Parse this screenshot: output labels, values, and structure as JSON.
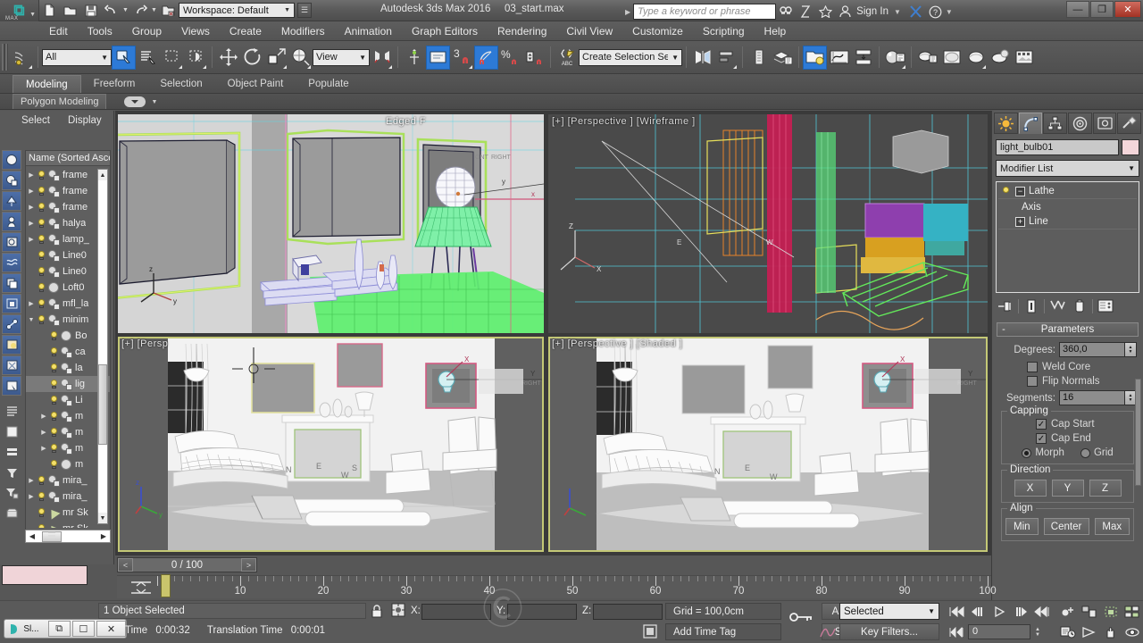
{
  "app": {
    "title": "Autodesk 3ds Max 2016",
    "file": "03_start.max",
    "logo_text": "MAX",
    "workspace_label": "Workspace: Default",
    "search_placeholder": "Type a keyword or phrase",
    "sign_in": "Sign In",
    "window_buttons": {
      "minimize": "—",
      "restore": "❐",
      "close": "✕"
    }
  },
  "menu": {
    "items": [
      "Edit",
      "Tools",
      "Group",
      "Views",
      "Create",
      "Modifiers",
      "Animation",
      "Graph Editors",
      "Rendering",
      "Civil View",
      "Customize",
      "Scripting",
      "Help"
    ]
  },
  "toolbar": {
    "selection_filter": "All",
    "reference_coord": "View",
    "named_selection_set": "Create Selection Se",
    "snap_number": "3",
    "percent_symbol": "%",
    "icons": [
      "undo-icon",
      "redo-icon",
      "select-link-icon",
      "unlink-icon",
      "bind-space-warp-icon",
      "select-object-icon",
      "select-by-name-icon",
      "rectangular-region-icon",
      "window-crossing-icon",
      "select-move-icon",
      "select-rotate-icon",
      "select-scale-icon",
      "reference-coordinate-icon",
      "use-pivot-center-icon",
      "mirror-icon",
      "align-icon",
      "layer-manager-icon",
      "snaps-toggle-icon",
      "angle-snap-icon",
      "percent-snap-icon",
      "spinner-snap-icon",
      "named-selection-sets-icon",
      "graphite-modeling-icon",
      "curve-editor-icon",
      "schematic-view-icon",
      "material-editor-icon",
      "render-setup-icon",
      "render-frame-icon",
      "render-production-icon",
      "material-explorer-icon"
    ]
  },
  "ribbon": {
    "tabs": [
      "Modeling",
      "Freeform",
      "Selection",
      "Object Paint",
      "Populate"
    ],
    "active_tab": "Modeling",
    "sub_tab": "Polygon Modeling"
  },
  "scene_explorer": {
    "menus": [
      "Select",
      "Display"
    ],
    "column_header": "Name (Sorted Ascer",
    "rows": [
      {
        "name": "frame",
        "expandable": true,
        "indent": 0,
        "icon": "group-icon"
      },
      {
        "name": "frame",
        "expandable": true,
        "indent": 0,
        "icon": "group-icon"
      },
      {
        "name": "frame",
        "expandable": true,
        "indent": 0,
        "icon": "group-icon"
      },
      {
        "name": "halya",
        "expandable": true,
        "indent": 0,
        "icon": "group-icon"
      },
      {
        "name": "lamp_",
        "expandable": true,
        "indent": 0,
        "icon": "group-icon"
      },
      {
        "name": "Line0",
        "expandable": false,
        "indent": 0,
        "icon": "shape-icon"
      },
      {
        "name": "Line0",
        "expandable": false,
        "indent": 0,
        "icon": "shape-icon"
      },
      {
        "name": "Loft0",
        "expandable": false,
        "indent": 0,
        "icon": "mesh-icon"
      },
      {
        "name": "mfl_la",
        "expandable": true,
        "indent": 0,
        "icon": "group-icon"
      },
      {
        "name": "minim",
        "expandable": true,
        "expanded": true,
        "indent": 0,
        "icon": "group-icon"
      },
      {
        "name": "Bo",
        "expandable": false,
        "indent": 1,
        "icon": "mesh-icon"
      },
      {
        "name": "ca",
        "expandable": false,
        "indent": 1,
        "icon": "shape-icon"
      },
      {
        "name": "la",
        "expandable": false,
        "indent": 1,
        "icon": "shape-icon"
      },
      {
        "name": "lig",
        "expandable": false,
        "indent": 1,
        "icon": "shape-icon",
        "selected": true
      },
      {
        "name": "Li",
        "expandable": false,
        "indent": 1,
        "icon": "shape-icon"
      },
      {
        "name": "m",
        "expandable": true,
        "indent": 1,
        "icon": "group-icon"
      },
      {
        "name": "m",
        "expandable": true,
        "indent": 1,
        "icon": "group-icon"
      },
      {
        "name": "m",
        "expandable": true,
        "indent": 1,
        "icon": "group-icon"
      },
      {
        "name": "m",
        "expandable": false,
        "indent": 1,
        "icon": "mesh-icon"
      },
      {
        "name": "mira_",
        "expandable": true,
        "indent": 0,
        "icon": "group-icon"
      },
      {
        "name": "mira_",
        "expandable": true,
        "indent": 0,
        "icon": "group-icon"
      },
      {
        "name": "mr Sk",
        "expandable": false,
        "indent": 0,
        "icon": "light-icon"
      },
      {
        "name": "mr Sk",
        "expandable": false,
        "indent": 0,
        "icon": "light-icon"
      }
    ]
  },
  "viewports": [
    {
      "id": "top-left",
      "label": "Edged F",
      "shading": "Edged Faces",
      "selected": false
    },
    {
      "id": "top-right",
      "label": "[+] [Perspective ] [Wireframe ]",
      "selected": false
    },
    {
      "id": "bottom-left",
      "label": "[+] [Persp",
      "selected": true
    },
    {
      "id": "bottom-right",
      "label": "[+] [Perspective ] [Shaded ]",
      "selected": true
    }
  ],
  "command_panel": {
    "tabs": [
      "create-tab",
      "modify-tab",
      "hierarchy-tab",
      "motion-tab",
      "display-tab",
      "utilities-tab"
    ],
    "active_tab_index": 1,
    "object_name": "light_bulb01",
    "modifier_list_label": "Modifier List",
    "stack": [
      {
        "label": "Lathe",
        "type": "modifier",
        "expanded": true,
        "has_bulb": true
      },
      {
        "label": "Axis",
        "type": "sub-object",
        "indent": 1
      },
      {
        "label": "Line",
        "type": "base-object",
        "collapsed": true
      }
    ],
    "rollout": {
      "title": "Parameters",
      "collapse_glyph": "-",
      "degrees_label": "Degrees:",
      "degrees_value": "360,0",
      "weld_core_label": "Weld Core",
      "weld_core_checked": false,
      "flip_normals_label": "Flip Normals",
      "flip_normals_checked": false,
      "segments_label": "Segments:",
      "segments_value": "16",
      "capping_group": "Capping",
      "cap_start_label": "Cap Start",
      "cap_start_checked": true,
      "cap_end_label": "Cap End",
      "cap_end_checked": true,
      "morph_label": "Morph",
      "morph_selected": true,
      "grid_label": "Grid",
      "grid_selected": false,
      "direction_group": "Direction",
      "direction_buttons": [
        "X",
        "Y",
        "Z"
      ],
      "align_group": "Align",
      "align_buttons": [
        "Min",
        "Center",
        "Max"
      ]
    }
  },
  "timeline": {
    "current_frame_display": "0 / 100",
    "prev_arrow": "<",
    "next_arrow": ">",
    "tick_labels": [
      "10",
      "20",
      "30",
      "40",
      "50",
      "60",
      "70",
      "80",
      "90",
      "100"
    ],
    "range_start": 0,
    "range_end": 100,
    "slider_position": 0
  },
  "status_bar": {
    "selection_status": "1 Object Selected",
    "time_label": "Time",
    "time_value": "0:00:32",
    "translation_time_label": "Translation Time",
    "translation_time_value": "0:00:01",
    "coord_x_label": "X:",
    "coord_y_label": "Y:",
    "coord_z_label": "Z:",
    "coord_x_value": "",
    "coord_y_value": "",
    "coord_z_value": "",
    "grid_text": "Grid = 100,0cm",
    "add_time_tag": "Add Time Tag",
    "auto_key": "Auto Key",
    "set_key": "Set Key",
    "key_mode_selected": "Selected",
    "key_filters": "Key Filters...",
    "frame_field_value": "0",
    "taskbar_app": "Sl..."
  }
}
